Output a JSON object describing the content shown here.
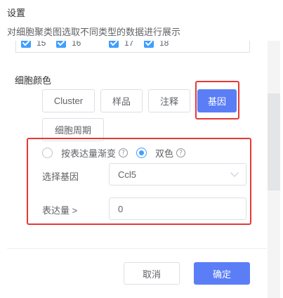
{
  "dialog": {
    "title": "设置",
    "subtitle": "对细胞聚类图选取不同类型的数据进行展示"
  },
  "checkbox_strip": {
    "items": [
      {
        "label": "15",
        "checked": true
      },
      {
        "label": "16",
        "checked": true
      },
      {
        "label": "17",
        "checked": true
      },
      {
        "label": "18",
        "checked": true
      }
    ]
  },
  "cell_color": {
    "label": "细胞颜色",
    "tabs": [
      {
        "label": "Cluster",
        "active": false
      },
      {
        "label": "样品",
        "active": false
      },
      {
        "label": "注释",
        "active": false
      },
      {
        "label": "基因",
        "active": true
      },
      {
        "label": "细胞周期",
        "active": false
      }
    ]
  },
  "gene_options": {
    "radio_gradient_label": "按表达量渐变",
    "radio_dual_label": "双色",
    "selected_mode": "双色",
    "help_glyph": "?",
    "select_gene_label": "选择基因",
    "select_gene_value": "Ccl5",
    "expression_label": "表达量 >",
    "expression_value": "0"
  },
  "footer": {
    "cancel_label": "取消",
    "confirm_label": "确定"
  },
  "colors": {
    "primary": "#5b7ef7",
    "highlight_border": "#e53935"
  }
}
